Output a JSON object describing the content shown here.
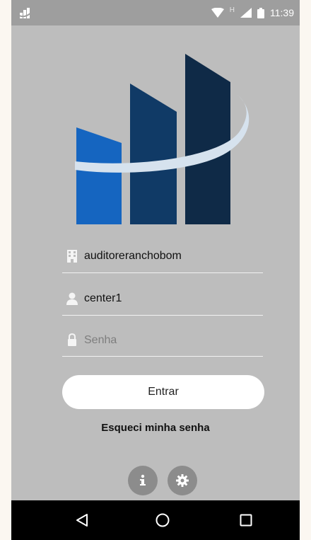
{
  "status_bar": {
    "time": "11:39",
    "network_label": "H",
    "icons": [
      "app-notification-icon",
      "wifi-icon",
      "signal-icon",
      "battery-icon"
    ]
  },
  "logo": {
    "name": "building-logo",
    "colors": {
      "bar_light": "#1565c0",
      "bar_mid": "#103a66",
      "bar_dark": "#0f2a47",
      "swoosh": "#d6e2ee"
    }
  },
  "form": {
    "company": {
      "value": "auditoreranchobom",
      "icon": "building-icon"
    },
    "user": {
      "value": "center1",
      "icon": "user-icon"
    },
    "password": {
      "placeholder": "Senha",
      "icon": "lock-icon"
    },
    "submit_label": "Entrar",
    "forgot_label": "Esqueci minha senha"
  },
  "bottom_actions": {
    "info_icon": "info-icon",
    "settings_icon": "gear-icon",
    "button_color": "#8c8c8c"
  },
  "nav_bar": {
    "back_icon": "back-icon",
    "home_icon": "home-icon",
    "recents_icon": "recents-icon"
  },
  "colors": {
    "background": "#bdbdbd",
    "status_bar": "#9e9e9e",
    "nav_bar": "#000000",
    "button": "#ffffff"
  }
}
